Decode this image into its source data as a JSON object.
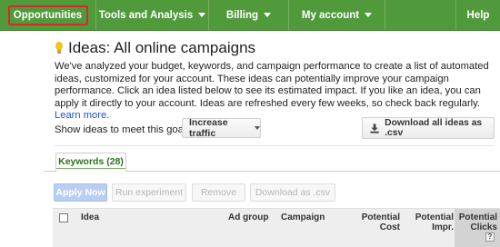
{
  "nav": {
    "opportunities": "Opportunities",
    "tools": "Tools and Analysis",
    "billing": "Billing",
    "account": "My account",
    "help": "Help"
  },
  "page": {
    "title": "Ideas: All online campaigns",
    "description": "We've analyzed your budget, keywords, and campaign performance to create a list of automated ideas, customized for your account. These ideas can potentially improve your campaign performance. Click an idea listed below to see its estimated impact. If you like an idea, you can apply it directly to your account. Ideas are refreshed every few weeks, so check back regularly.",
    "learn_more": "Learn more."
  },
  "goal": {
    "label": "Show ideas to meet this goal:",
    "selected": "Increase traffic"
  },
  "download_all": "Download all ideas as .csv",
  "tabs": [
    {
      "label": "Keywords (28)"
    }
  ],
  "actions": {
    "apply": "Apply Now",
    "run": "Run experiment",
    "remove": "Remove",
    "download_csv": "Download as .csv"
  },
  "table": {
    "columns": {
      "idea": "Idea",
      "ad_group": "Ad group",
      "campaign": "Campaign",
      "cost_line1": "Potential",
      "cost_line2": "Cost",
      "impr_line1": "Potential",
      "impr_line2": "Impr.",
      "clicks_line1": "Potential",
      "clicks_line2": "Clicks",
      "help": "?"
    }
  },
  "colors": {
    "nav_bg": "#519a3c",
    "highlight": "#d62a2a",
    "link": "#1a55c2",
    "tab_text": "#2d6f1d",
    "apply_bg": "#b8cef3"
  }
}
